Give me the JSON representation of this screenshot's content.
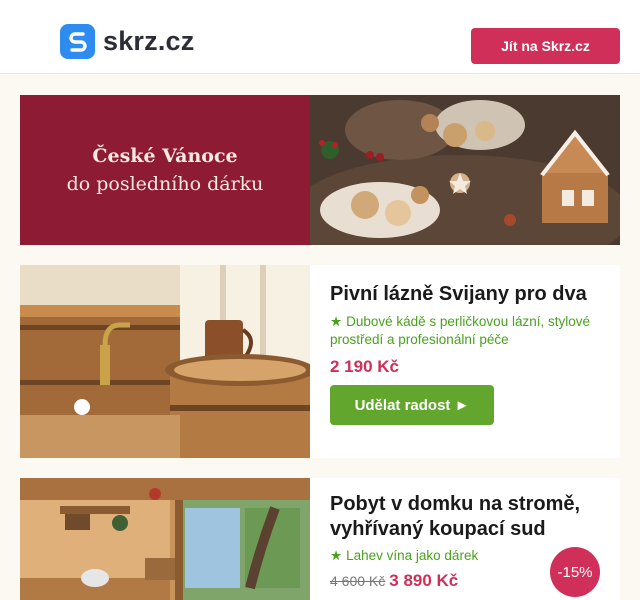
{
  "header": {
    "logo_text": "skrz.cz",
    "cta_label": "Jít na Skrz.cz"
  },
  "banner": {
    "line1": "České Vánoce",
    "line2": "do posledního dárku"
  },
  "cards": [
    {
      "title": "Pivní lázně Svijany pro dva",
      "feature": "Dubové kádě s perličkovou lázní, stylové prostředí a profesionální péče",
      "price": "2 190 Kč",
      "button_label": "Udělat radost ►"
    },
    {
      "title": "Pobyt v domku na stromě, vyhřívaný koupací sud",
      "feature": "Lahev vína jako dárek",
      "old_price": "4 600 Kč",
      "price": "3 890 Kč",
      "discount": "-15%"
    }
  ],
  "colors": {
    "brand_pink": "#cf2f58",
    "banner_red": "#8c1b33",
    "green": "#62a62d",
    "logo_blue": "#2e8cf0"
  }
}
